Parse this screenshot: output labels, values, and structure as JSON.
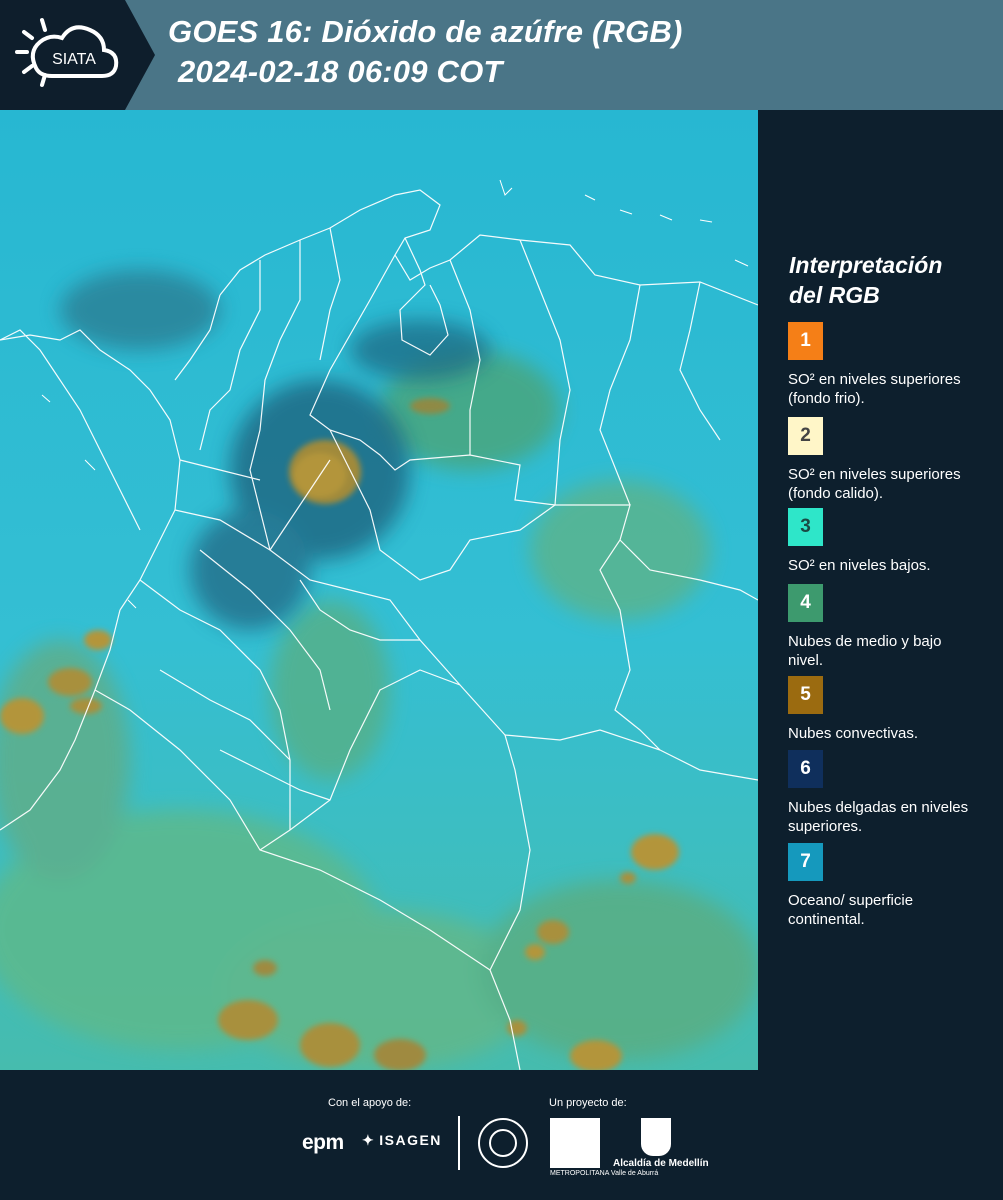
{
  "header": {
    "logo_text": "SIATA",
    "title": "GOES 16: Dióxido de azúfre (RGB)",
    "datetime": "2024-02-18 06:09 COT"
  },
  "legend": {
    "title_line1": "Interpretación",
    "title_line2": "del RGB",
    "items": [
      {
        "number": "1",
        "color": "#f57f17",
        "text_color": "#ffffff",
        "label": "SO² en niveles superiores (fondo frio)."
      },
      {
        "number": "2",
        "color": "#fff6c8",
        "text_color": "#444444",
        "label": "SO² en niveles superiores (fondo calido)."
      },
      {
        "number": "3",
        "color": "#2ee6c9",
        "text_color": "#1a4a44",
        "label": "SO² en niveles bajos."
      },
      {
        "number": "4",
        "color": "#3d9a6e",
        "text_color": "#ffffff",
        "label": "Nubes de medio y bajo nivel."
      },
      {
        "number": "5",
        "color": "#9b6b10",
        "text_color": "#ffffff",
        "label": "Nubes convectivas."
      },
      {
        "number": "6",
        "color": "#0f2f5c",
        "text_color": "#ffffff",
        "label": "Nubes delgadas en niveles superiores."
      },
      {
        "number": "7",
        "color": "#1599bd",
        "text_color": "#ffffff",
        "label": "Oceano/ superficie continental."
      }
    ]
  },
  "footer": {
    "support_label": "Con el apoyo de:",
    "project_label": "Un proyecto de:",
    "sponsor_1": "epm",
    "sponsor_2": "ISAGEN",
    "partner_1_label": "METROPOLITANA Valle de Aburrá",
    "partner_2_label": "Alcaldía de Medellín"
  }
}
